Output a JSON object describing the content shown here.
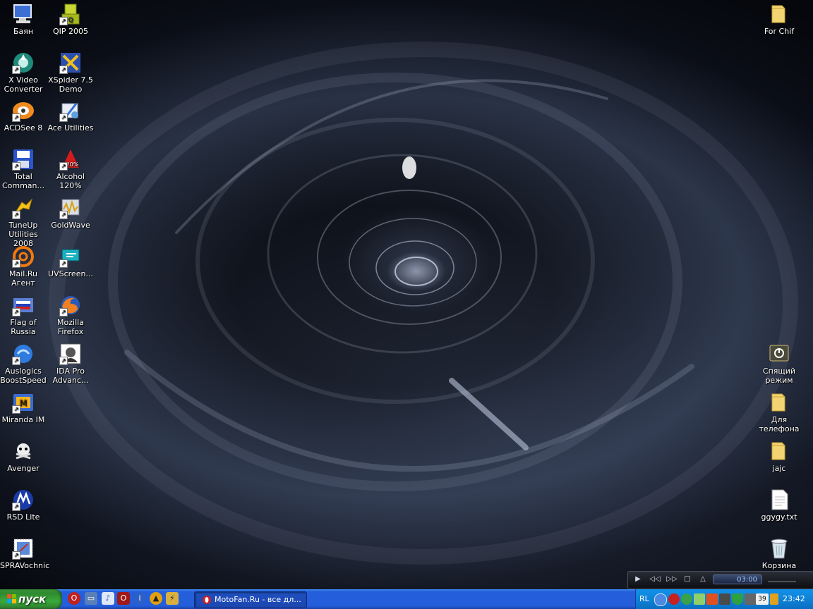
{
  "desktop": {
    "left_icons": [
      {
        "label": "Баян",
        "icon": "computer-icon"
      },
      {
        "label": "QIP 2005",
        "icon": "qip-icon"
      },
      {
        "label": "X Video Converter",
        "icon": "video-converter-icon"
      },
      {
        "label": "XSpider 7.5 Demo",
        "icon": "xspider-icon"
      },
      {
        "label": "ACDSee 8",
        "icon": "acdsee-icon"
      },
      {
        "label": "Ace Utilities",
        "icon": "ace-utilities-icon"
      },
      {
        "label": "Total Comman...",
        "icon": "floppy-icon"
      },
      {
        "label": "Alcohol 120%",
        "icon": "alcohol-icon"
      },
      {
        "label": "TuneUp Utilities 2008",
        "icon": "tuneup-icon"
      },
      {
        "label": "GoldWave",
        "icon": "goldwave-icon"
      },
      {
        "label": "Mail.Ru Агент",
        "icon": "mailru-agent-icon"
      },
      {
        "label": "UVScreen...",
        "icon": "uvscreen-icon"
      },
      {
        "label": "Flag of Russia",
        "icon": "flag-icon"
      },
      {
        "label": "Mozilla Firefox",
        "icon": "firefox-icon"
      },
      {
        "label": "Auslogics BoostSpeed",
        "icon": "boostspeed-icon"
      },
      {
        "label": "IDA Pro Advanc...",
        "icon": "ida-pro-icon"
      },
      {
        "label": "Miranda IM",
        "icon": "miranda-icon"
      },
      {
        "label": "Avenger",
        "icon": "avenger-icon"
      },
      {
        "label": "RSD Lite",
        "icon": "motorola-icon"
      },
      {
        "label": "SPRAVochnic",
        "icon": "stamp-icon"
      }
    ],
    "right_icons": [
      {
        "label": "For Chif",
        "icon": "folder-icon"
      },
      {
        "label": "Спящий режим",
        "icon": "power-icon"
      },
      {
        "label": "Для телефона",
        "icon": "folder-icon"
      },
      {
        "label": "jajc",
        "icon": "folder-icon"
      },
      {
        "label": "ggygy.txt",
        "icon": "text-file-icon"
      },
      {
        "label": "Корзина",
        "icon": "recycle-bin-icon"
      }
    ]
  },
  "player": {
    "time": "03:00"
  },
  "taskbar": {
    "start_label": "пуск",
    "task_button": "MotoFan.Ru - все дл...",
    "language": "RL",
    "tray_badge": "39",
    "clock": "23:42"
  },
  "colors": {
    "taskbar_blue": "#245edb",
    "start_green": "#3aa93a",
    "tray_blue": "#0f83d7"
  }
}
